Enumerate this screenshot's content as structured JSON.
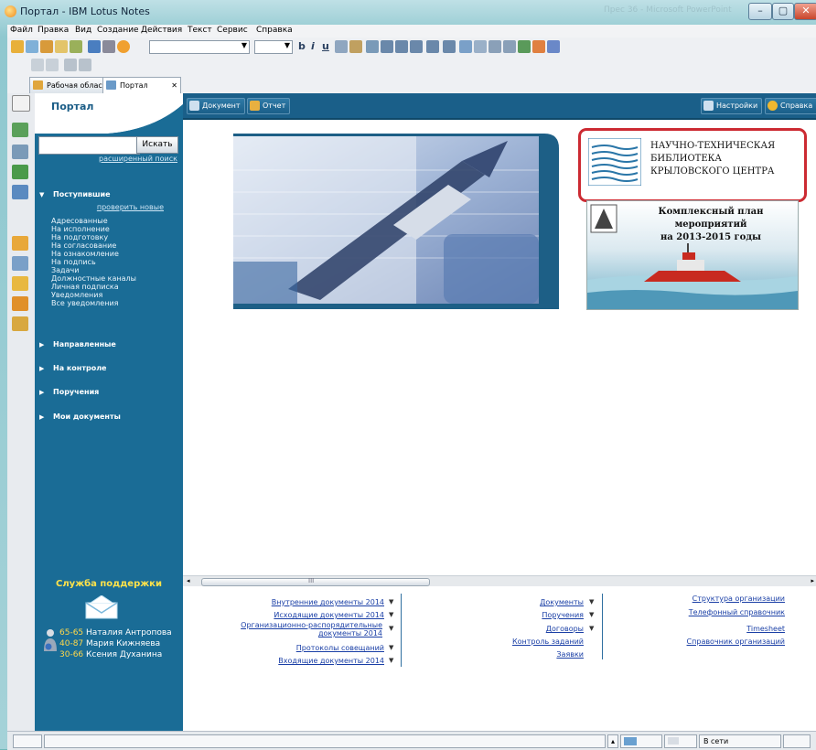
{
  "window": {
    "title": "Портал - IBM Lotus Notes",
    "background_app": "Прес 36 - Microsoft PowerPoint",
    "controls": {
      "minimize": "–",
      "maximize": "▢",
      "close": "✕"
    }
  },
  "menubar": [
    "Файл",
    "Правка",
    "Вид",
    "Создание",
    "Действия",
    "Текст",
    "Сервис",
    "Справка"
  ],
  "toolbar": {
    "format_glyphs": [
      "b",
      "i",
      "u"
    ]
  },
  "tabs": [
    {
      "label": "Рабочая область"
    },
    {
      "label": "Портал",
      "close": "✕"
    }
  ],
  "sidebar": {
    "title": "Портал",
    "search_button": "Искать",
    "advanced_search": "расширенный поиск",
    "sections": [
      {
        "label": "Поступившие",
        "expanded": true
      },
      {
        "label": "Направленные"
      },
      {
        "label": "На контроле"
      },
      {
        "label": "Поручения"
      },
      {
        "label": "Мои документы"
      }
    ],
    "check_new": "проверить новые",
    "inbox_items": [
      "Адресованные",
      "На исполнение",
      "На подготовку",
      "На согласование",
      "На ознакомление",
      "На подпись",
      "Задачи",
      "Должностные каналы",
      "Личная подписка",
      "Уведомления",
      "Все уведомления"
    ],
    "support": {
      "title": "Служба поддержки",
      "contacts": [
        {
          "number": "65-65",
          "name": "Наталия Антропова"
        },
        {
          "number": "40-87",
          "name": "Мария Кижняева"
        },
        {
          "number": "30-66",
          "name": "Ксения Духанина"
        }
      ]
    }
  },
  "main_toolbar": {
    "left": [
      "Документ",
      "Отчет"
    ],
    "right": [
      "Настройки",
      "Справка"
    ]
  },
  "content": {
    "library": [
      "НАУЧНО-ТЕХНИЧЕСКАЯ",
      "БИБЛИОТЕКА",
      "КРЫЛОВСКОГО ЦЕНТРА"
    ],
    "plan": [
      "Комплексный план",
      "мероприятий",
      "на 2013-2015 годы"
    ],
    "scroll_thumb_label": "III"
  },
  "footer": {
    "col1": [
      "Внутренние документы 2014",
      "Исходящие документы 2014",
      "Организационно-распорядительные документы 2014",
      "Протоколы совещаний",
      "Входящие документы 2014"
    ],
    "col2": [
      "Документы",
      "Поручения",
      "Договоры",
      "Контроль заданий",
      "Заявки"
    ],
    "col3": [
      "Структура организации",
      "Телефонный справочник",
      "Timesheet",
      "Справочник организаций"
    ]
  },
  "statusbar": {
    "network": "В сети"
  },
  "colors": {
    "sidebar_blue": "#1a6c96",
    "support_yellow": "#ffe24a",
    "highlight_red": "#cc2a32",
    "link_blue": "#1a3fa6"
  }
}
